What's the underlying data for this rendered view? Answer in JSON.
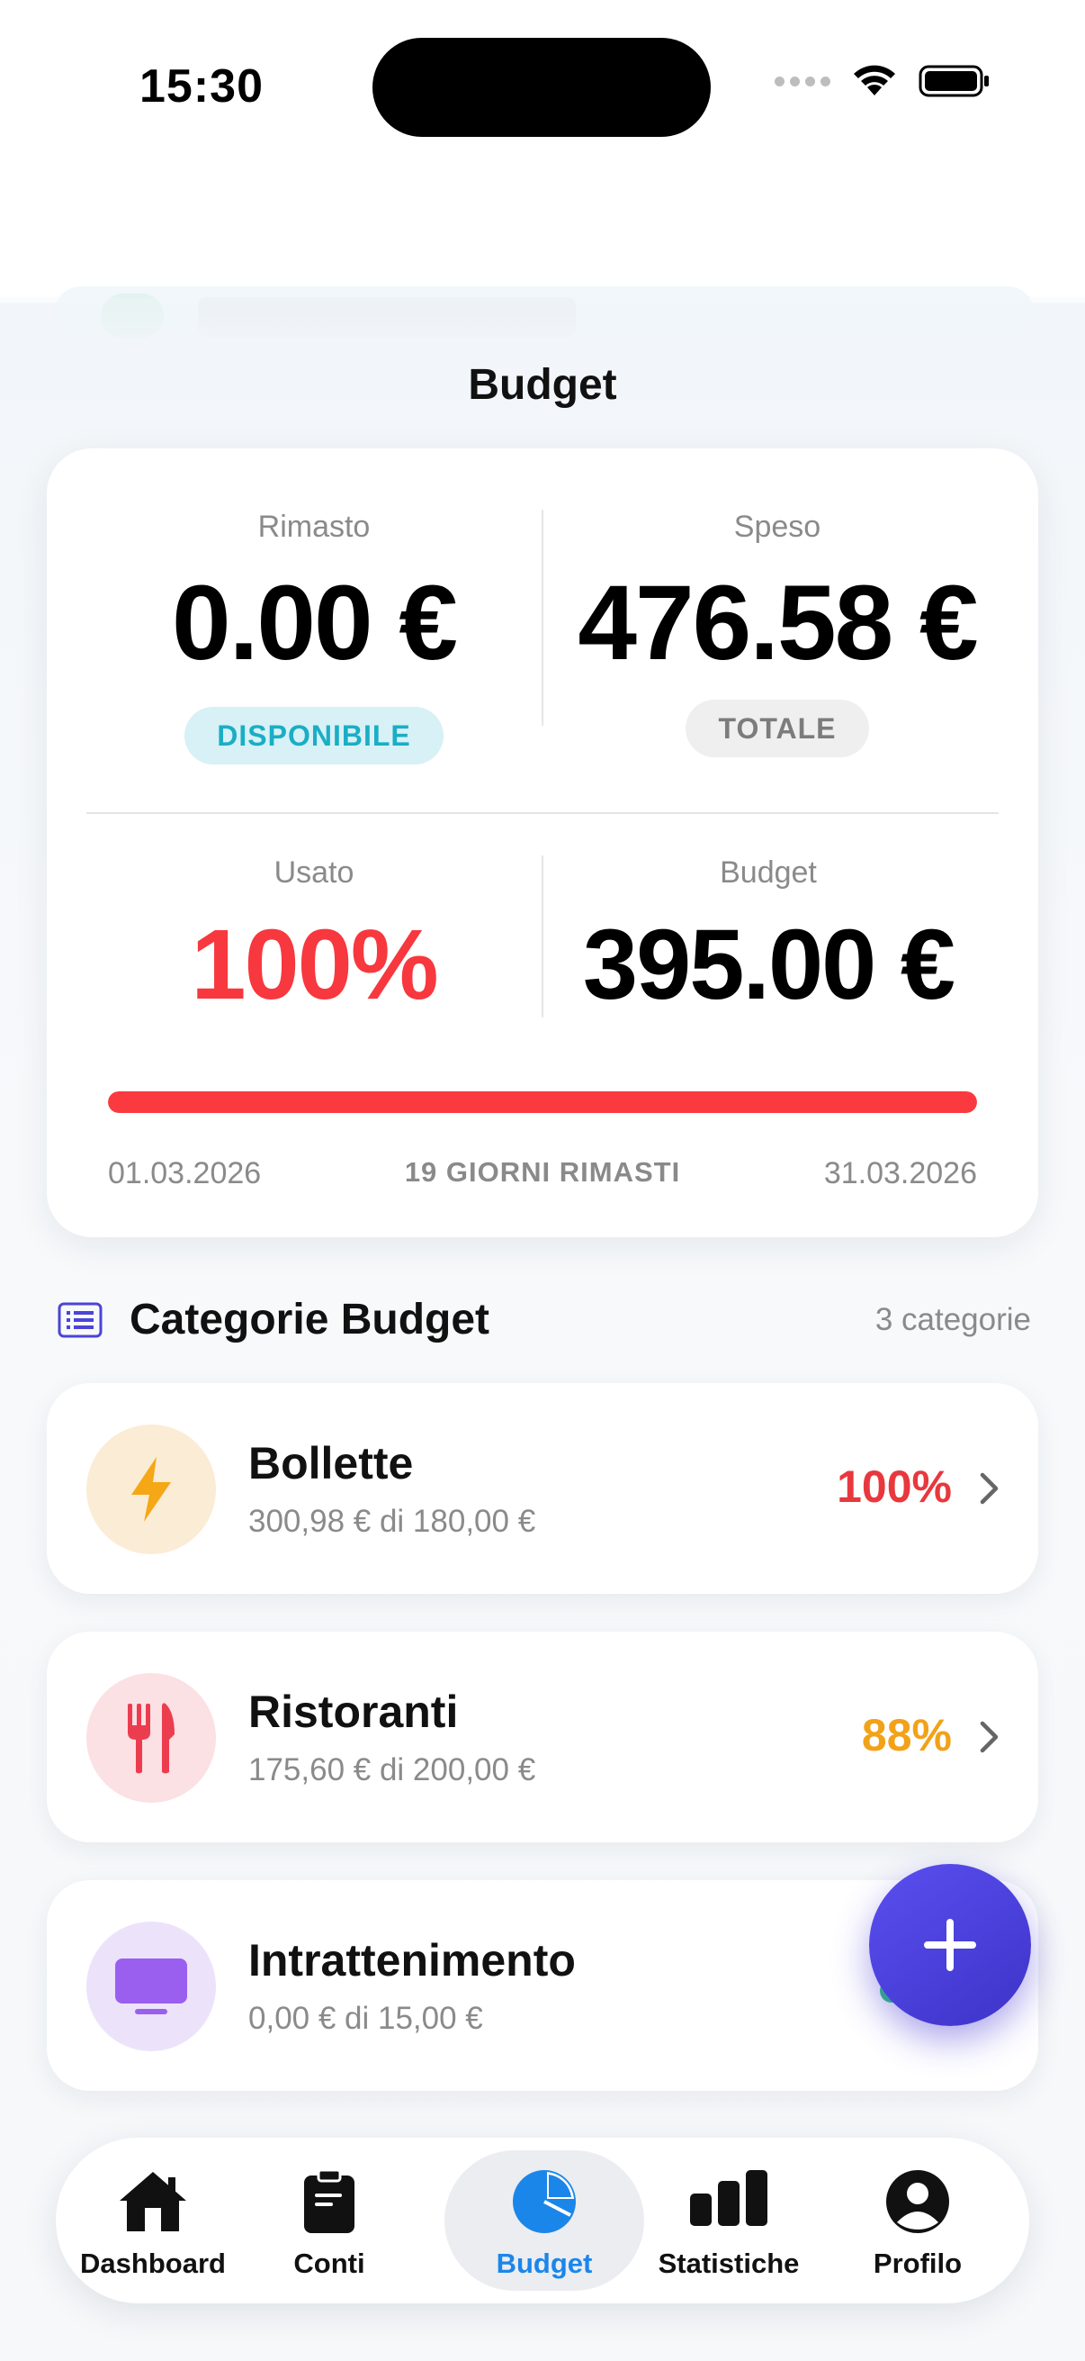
{
  "status_bar": {
    "time": "15:30"
  },
  "page": {
    "title": "Budget"
  },
  "summary": {
    "remaining": {
      "label": "Rimasto",
      "value": "0.00 €",
      "badge": "DISPONIBILE"
    },
    "spent": {
      "label": "Speso",
      "value": "476.58 €",
      "badge": "TOTALE"
    },
    "used": {
      "label": "Usato",
      "value": "100%"
    },
    "budget": {
      "label": "Budget",
      "value": "395.00 €"
    },
    "progress_fraction": 1.0,
    "start_date": "01.03.2026",
    "days_left": "19 GIORNI RIMASTI",
    "end_date": "31.03.2026"
  },
  "categories_header": {
    "title": "Categorie Budget",
    "count": "3 categorie"
  },
  "categories": [
    {
      "name": "Bollette",
      "sub": "300,98 € di 180,00 €",
      "percent": "100%",
      "icon": "lightning-icon",
      "pct_color": "#e8383e",
      "avatar_bg": "#fbecd5",
      "icon_color": "#f5a716"
    },
    {
      "name": "Ristoranti",
      "sub": "175,60 € di 200,00 €",
      "percent": "88%",
      "icon": "fork-knife-icon",
      "pct_color": "#f2a219",
      "avatar_bg": "#fbe0e4",
      "icon_color": "#ec3d4f"
    },
    {
      "name": "Intrattenimento",
      "sub": "0,00 € di 15,00 €",
      "percent": "",
      "icon": "tv-icon",
      "pct_color": "#2ec27e",
      "avatar_bg": "#ece3fb",
      "icon_color": "#9b5ff0"
    }
  ],
  "fab": {
    "icon": "plus-icon"
  },
  "tabs": [
    {
      "label": "Dashboard",
      "icon": "home-icon"
    },
    {
      "label": "Conti",
      "icon": "clipboard-icon"
    },
    {
      "label": "Budget",
      "icon": "pie-chart-icon",
      "active": true
    },
    {
      "label": "Statistiche",
      "icon": "bar-chart-icon"
    },
    {
      "label": "Profilo",
      "icon": "person-icon"
    }
  ],
  "colors": {
    "accent": "#1b86ea",
    "danger": "#f7383e",
    "fab": "#4a40dc"
  }
}
